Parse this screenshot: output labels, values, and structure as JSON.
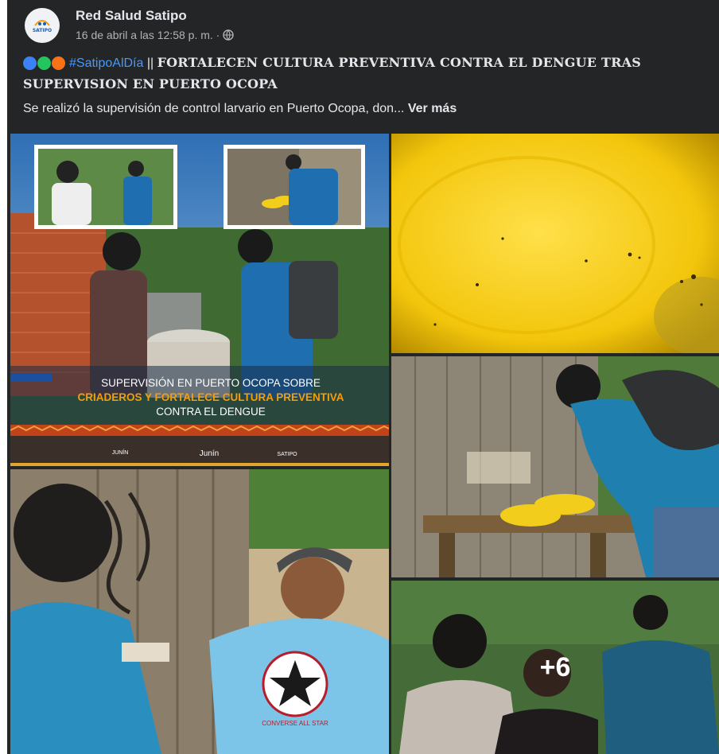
{
  "post": {
    "page_name": "Red Salud Satipo",
    "timestamp": "16 de abril a las 12:58 p. m. ·",
    "privacy_icon": "globe-icon",
    "avatar_label": "SATIPO",
    "headline": {
      "dot_colors": [
        "#3b82f6",
        "#22c55e",
        "#f97316"
      ],
      "hashtag": "#SatipoAlDía",
      "separator": " || ",
      "title": "FORTALECEN CULTURA PREVENTIVA CONTRA EL DENGUE TRAS SUPERVISION EN PUERTO OCOPA"
    },
    "body": "Se realizó la supervisión de control larvario en Puerto Ocopa, don...",
    "see_more": "Ver más"
  },
  "poster": {
    "line1": "SUPERVISIÓN EN PUERTO OCOPA SOBRE",
    "line2": "CRIADEROS Y FORTALECE CULTURA PREVENTIVA",
    "line3": "CONTRA EL DENGUE",
    "logos": [
      "JUNÍN",
      "Junín",
      "SATIPO"
    ]
  },
  "shirt_text": "CONVERSE ALL STAR",
  "more_photos": "+6",
  "colors": {
    "background": "#242526",
    "text": "#e4e6eb",
    "secondary": "#b0b3b8",
    "link": "#4599ff",
    "accent_orange": "#f59e0b"
  }
}
